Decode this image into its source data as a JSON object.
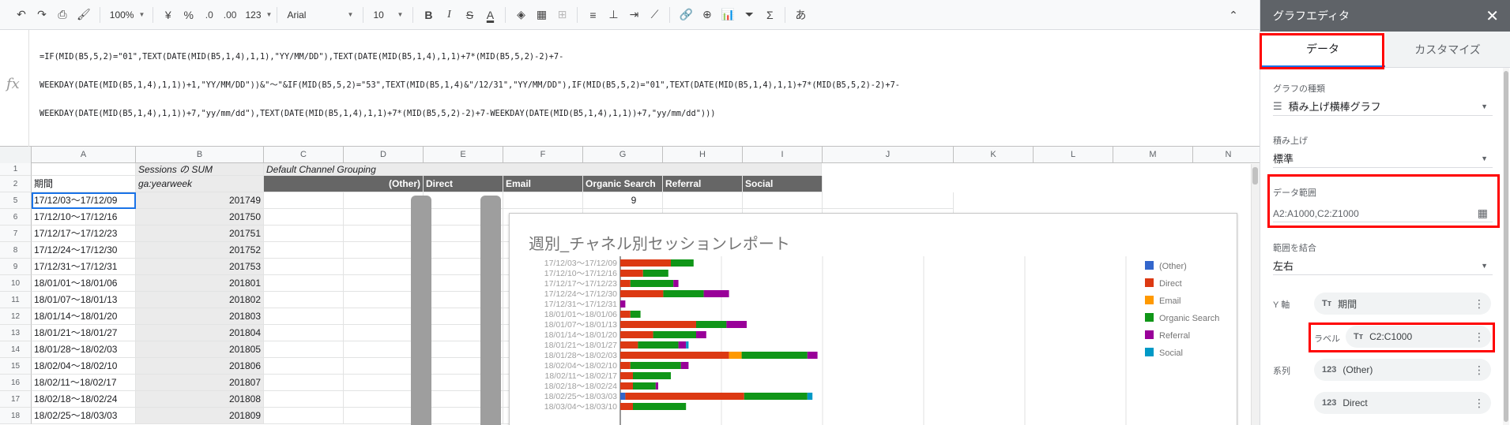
{
  "toolbar": {
    "zoom": "100%",
    "currency": "¥",
    "percent": "%",
    "dec_decrease": ".0",
    "dec_increase": ".00",
    "format": "123",
    "font": "Arial",
    "font_size": "10",
    "bold": "B",
    "italic": "I",
    "strike": "S",
    "text_color": "A",
    "sum": "Σ",
    "input_method": "あ"
  },
  "formula": {
    "fx": "fx",
    "lines": [
      "=IF(MID(B5,5,2)=\"01\",TEXT(DATE(MID(B5,1,4),1,1),\"YY/MM/DD\"),TEXT(DATE(MID(B5,1,4),1,1)+7*(MID(B5,5,2)-2)+7-",
      "WEEKDAY(DATE(MID(B5,1,4),1,1))+1,\"YY/MM/DD\"))&\"～\"&IF(MID(B5,5,2)=\"53\",TEXT(MID(B5,1,4)&\"/12/31\",\"YY/MM/DD\"),IF(MID(B5,5,2)=\"01\",TEXT(DATE(MID(B5,1,4),1,1)+7*(MID(B5,5,2)-2)+7-",
      "WEEKDAY(DATE(MID(B5,1,4),1,1))+7,\"yy/mm/dd\"),TEXT(DATE(MID(B5,1,4),1,1)+7*(MID(B5,5,2)-2)+7-WEEKDAY(DATE(MID(B5,1,4),1,1))+7,\"yy/mm/dd\")))"
    ]
  },
  "columns": [
    "A",
    "B",
    "C",
    "D",
    "E",
    "F",
    "G",
    "H",
    "I",
    "J",
    "K",
    "L",
    "M",
    "N"
  ],
  "header_row1": {
    "b": "Sessions の SUM",
    "c": "Default Channel Grouping"
  },
  "header_row2": {
    "a": "期間",
    "b": "ga:yearweek",
    "d": "(Other)",
    "e": "Direct",
    "f": "Email",
    "g": "Organic Search",
    "h": "Referral",
    "i": "Social"
  },
  "g5_value": "9",
  "rows": [
    {
      "num": "5",
      "period": "17/12/03～17/12/09",
      "yw": "201749"
    },
    {
      "num": "6",
      "period": "17/12/10～17/12/16",
      "yw": "201750"
    },
    {
      "num": "7",
      "period": "17/12/17～17/12/23",
      "yw": "201751"
    },
    {
      "num": "8",
      "period": "17/12/24～17/12/30",
      "yw": "201752"
    },
    {
      "num": "9",
      "period": "17/12/31～17/12/31",
      "yw": "201753"
    },
    {
      "num": "10",
      "period": "18/01/01～18/01/06",
      "yw": "201801"
    },
    {
      "num": "11",
      "period": "18/01/07～18/01/13",
      "yw": "201802"
    },
    {
      "num": "12",
      "period": "18/01/14～18/01/20",
      "yw": "201803"
    },
    {
      "num": "13",
      "period": "18/01/21～18/01/27",
      "yw": "201804"
    },
    {
      "num": "14",
      "period": "18/01/28～18/02/03",
      "yw": "201805"
    },
    {
      "num": "15",
      "period": "18/02/04～18/02/10",
      "yw": "201806"
    },
    {
      "num": "16",
      "period": "18/02/11～18/02/17",
      "yw": "201807"
    },
    {
      "num": "17",
      "period": "18/02/18～18/02/24",
      "yw": "201808"
    },
    {
      "num": "18",
      "period": "18/02/25～18/03/03",
      "yw": "201809"
    }
  ],
  "chart_data": {
    "type": "bar",
    "orientation": "horizontal",
    "stacked": true,
    "title": "週別_チャネル別セッションレポート",
    "categories": [
      "17/12/03～17/12/09",
      "17/12/10～17/12/16",
      "17/12/17～17/12/23",
      "17/12/24～17/12/30",
      "17/12/31～17/12/31",
      "18/01/01～18/01/06",
      "18/01/07～18/01/13",
      "18/01/14～18/01/20",
      "18/01/21～18/01/27",
      "18/01/28～18/02/03",
      "18/02/04～18/02/10",
      "18/02/11～18/02/17",
      "18/02/18～18/02/24",
      "18/02/25～18/03/03",
      "18/03/04～18/03/10"
    ],
    "series": [
      {
        "name": "(Other)",
        "color": "#3366cc",
        "values": [
          0,
          0,
          0,
          0,
          0,
          0,
          0,
          0,
          0,
          0,
          0,
          0,
          0,
          2,
          0
        ]
      },
      {
        "name": "Direct",
        "color": "#dc3912",
        "values": [
          20,
          9,
          4,
          17,
          0,
          4,
          30,
          13,
          7,
          43,
          4,
          5,
          5,
          47,
          5
        ]
      },
      {
        "name": "Email",
        "color": "#ff9900",
        "values": [
          0,
          0,
          0,
          0,
          0,
          0,
          0,
          0,
          0,
          5,
          0,
          0,
          0,
          0,
          0
        ]
      },
      {
        "name": "Organic Search",
        "color": "#109618",
        "values": [
          9,
          10,
          17,
          16,
          0,
          4,
          12,
          17,
          16,
          26,
          20,
          15,
          9,
          25,
          21
        ]
      },
      {
        "name": "Referral",
        "color": "#990099",
        "values": [
          0,
          0,
          2,
          10,
          2,
          0,
          8,
          4,
          3,
          4,
          3,
          0,
          1,
          0,
          0
        ]
      },
      {
        "name": "Social",
        "color": "#0099c6",
        "values": [
          0,
          0,
          0,
          0,
          0,
          0,
          0,
          0,
          1,
          0,
          0,
          0,
          0,
          2,
          0
        ]
      }
    ],
    "legend_position": "right",
    "grid": true
  },
  "panel": {
    "title": "グラフエディタ",
    "close": "✕",
    "tab_data": "データ",
    "tab_custom": "カスタマイズ",
    "chart_type_label": "グラフの種類",
    "chart_type_value": "積み上げ横棒グラフ",
    "stack_label": "積み上げ",
    "stack_value": "標準",
    "range_label": "データ範囲",
    "range_value": "A2:A1000,C2:Z1000",
    "combine_label": "範囲を結合",
    "combine_value": "左右",
    "y_axis_label": "Y 軸",
    "y_axis_value": "期間",
    "label_label": "ラベル",
    "label_value": "C2:C1000",
    "series_label": "系列",
    "series_1": "(Other)",
    "series_2": "Direct",
    "text_icon": "Tт",
    "num_icon": "123"
  }
}
